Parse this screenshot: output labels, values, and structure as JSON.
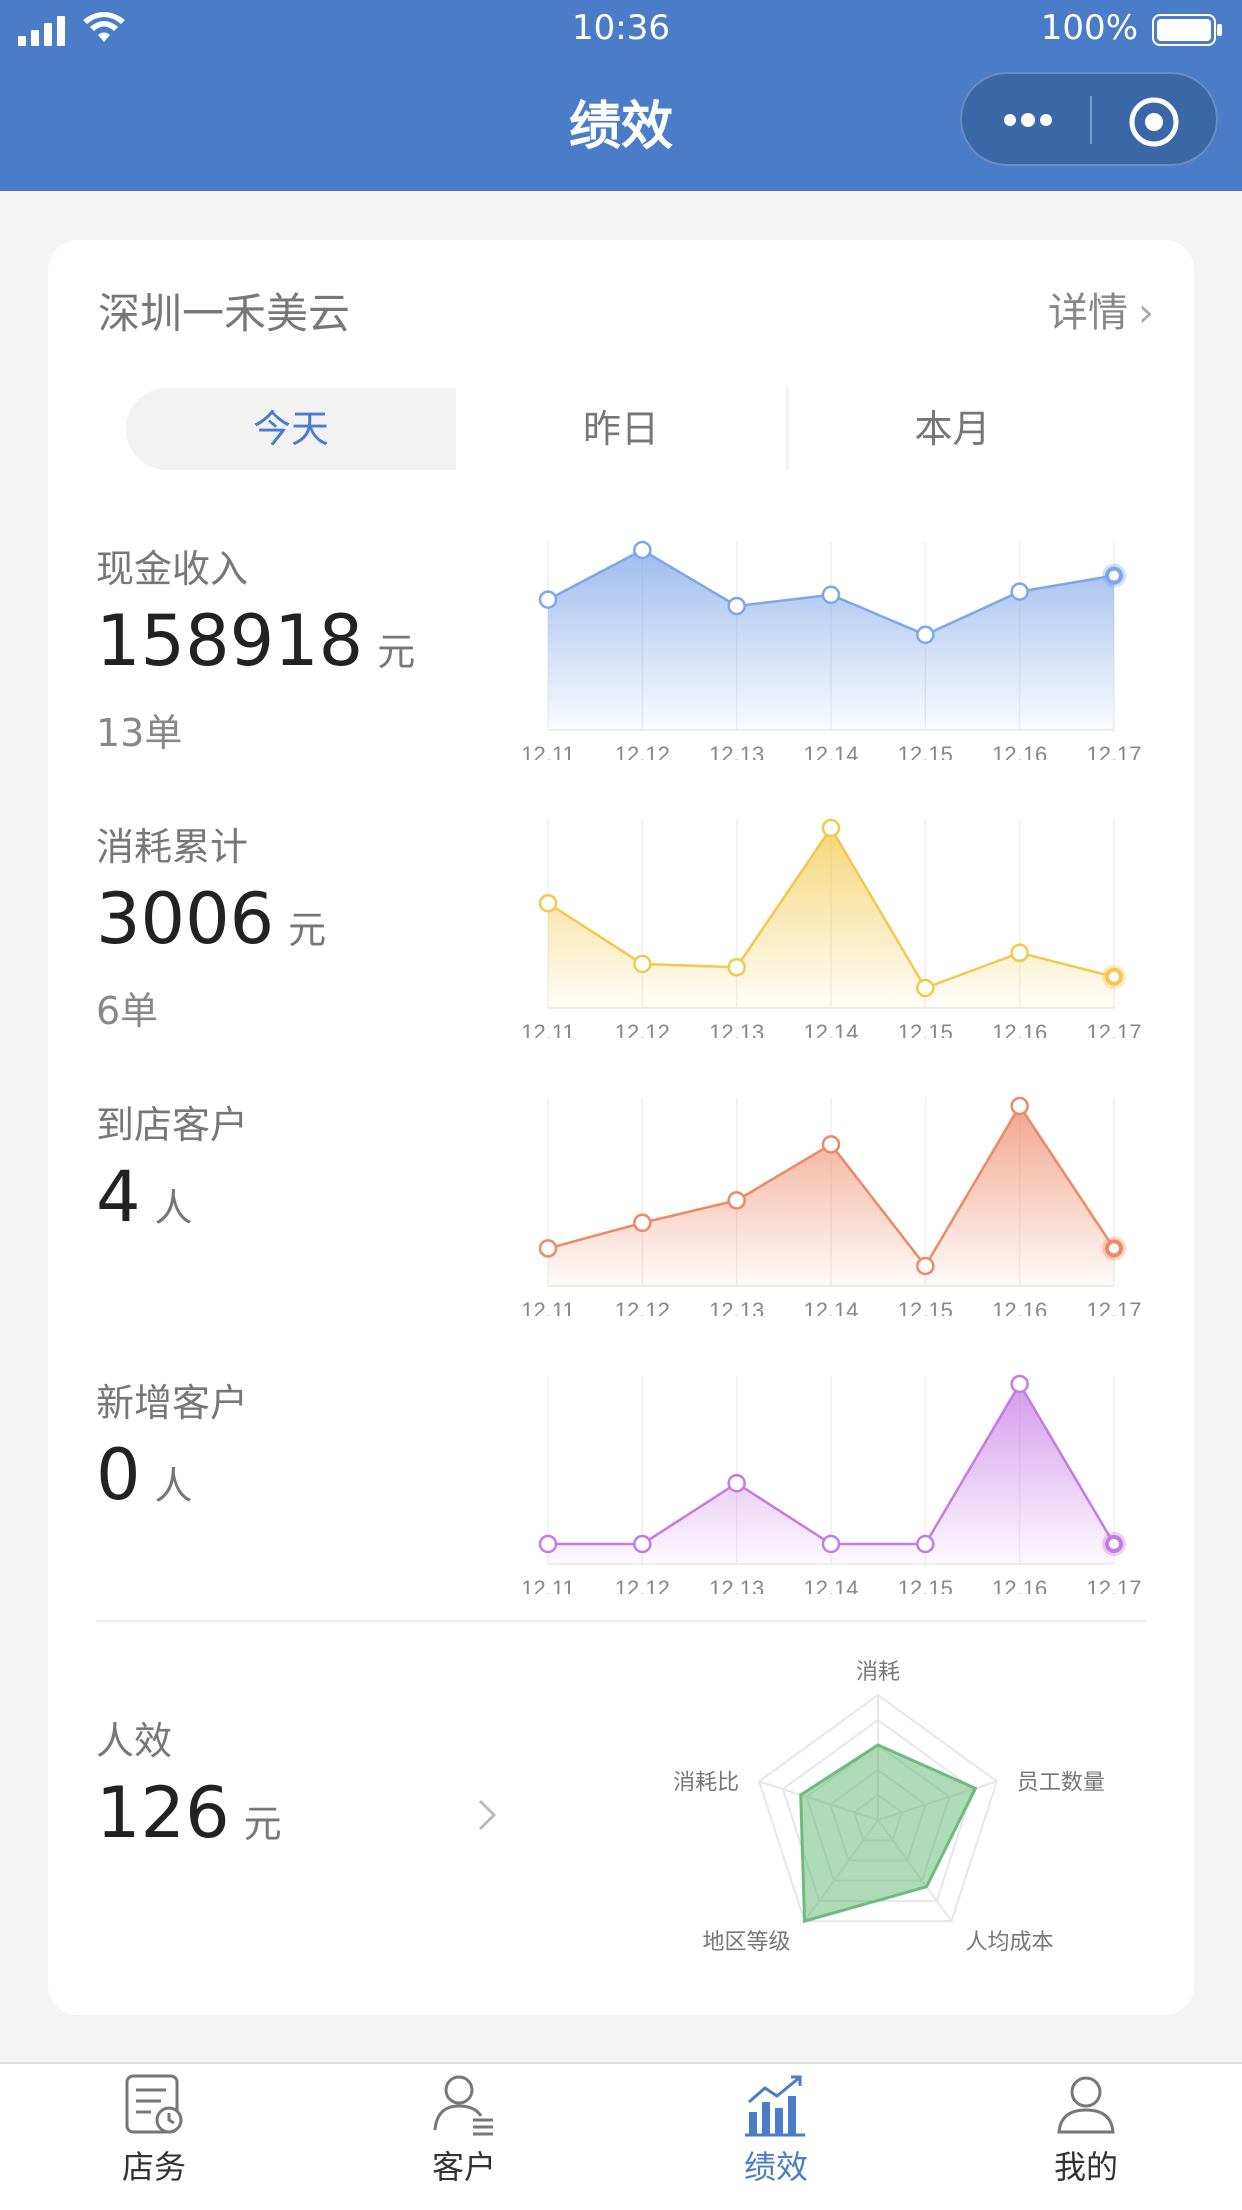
{
  "status_bar": {
    "time": "10:36",
    "battery": "100%"
  },
  "nav": {
    "title": "绩效"
  },
  "card": {
    "store_name": "深圳一禾美云",
    "detail_label": "详情",
    "tabs": [
      {
        "label": "今天",
        "active": true
      },
      {
        "label": "昨日",
        "active": false
      },
      {
        "label": "本月",
        "active": false
      }
    ],
    "metrics": [
      {
        "label": "现金收入",
        "value": "158918",
        "unit": "元",
        "sub": "13单",
        "color": "#7fa6e8"
      },
      {
        "label": "消耗累计",
        "value": "3006",
        "unit": "元",
        "sub": "6单",
        "color": "#f2c94c"
      },
      {
        "label": "到店客户",
        "value": "4",
        "unit": "人",
        "sub": "",
        "color": "#ee8867"
      },
      {
        "label": "新增客户",
        "value": "0",
        "unit": "人",
        "sub": "",
        "color": "#c57ae5"
      }
    ],
    "efficiency": {
      "label": "人效",
      "value": "126",
      "unit": "元"
    }
  },
  "chart_data": [
    {
      "type": "line",
      "x": [
        "12.11",
        "12.12",
        "12.13",
        "12.14",
        "12.15",
        "12.16",
        "12.17"
      ],
      "series": [
        {
          "values": [
            0.69,
            1.0,
            0.65,
            0.72,
            0.47,
            0.74,
            0.84
          ]
        }
      ]
    },
    {
      "type": "line",
      "x": [
        "12.11",
        "12.12",
        "12.13",
        "12.14",
        "12.15",
        "12.16",
        "12.17"
      ],
      "series": [
        {
          "values": [
            0.53,
            0.15,
            0.13,
            1.0,
            0.0,
            0.22,
            0.07
          ]
        }
      ]
    },
    {
      "type": "line",
      "x": [
        "12.11",
        "12.12",
        "12.13",
        "12.14",
        "12.15",
        "12.16",
        "12.17"
      ],
      "series": [
        {
          "values": [
            0.11,
            0.27,
            0.41,
            0.76,
            0.0,
            1.0,
            0.11
          ]
        }
      ]
    },
    {
      "type": "line",
      "x": [
        "12.11",
        "12.12",
        "12.13",
        "12.14",
        "12.15",
        "12.16",
        "12.17"
      ],
      "series": [
        {
          "values": [
            0.0,
            0.0,
            0.38,
            0.0,
            0.0,
            1.0,
            0.0
          ]
        }
      ]
    },
    {
      "type": "radar",
      "axes": [
        "消耗",
        "员工数量",
        "人均成本",
        "地区等级",
        "消耗比"
      ],
      "values": [
        0.6,
        0.82,
        0.66,
        1.0,
        0.65
      ],
      "color": "#6dbb7e"
    }
  ],
  "tabbar": [
    {
      "label": "店务",
      "active": false
    },
    {
      "label": "客户",
      "active": false
    },
    {
      "label": "绩效",
      "active": true
    },
    {
      "label": "我的",
      "active": false
    }
  ]
}
